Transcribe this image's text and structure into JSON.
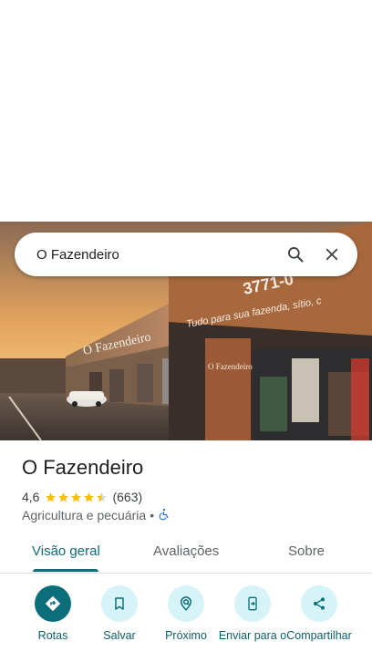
{
  "search": {
    "query": "O Fazendeiro"
  },
  "place": {
    "name": "O Fazendeiro",
    "rating": "4,6",
    "stars": 4.5,
    "review_count": "(663)",
    "category": "Agricultura e pecuária",
    "separator": "•"
  },
  "photo_signage": {
    "phone": "3771-0",
    "slogan": "Tudo para sua fazenda, sítio, c",
    "store_name": "O Fazendeiro"
  },
  "tabs": [
    {
      "label": "Visão geral",
      "active": true
    },
    {
      "label": "Avaliações",
      "active": false
    },
    {
      "label": "Sobre",
      "active": false
    }
  ],
  "actions": [
    {
      "label": "Rotas",
      "icon": "directions-icon"
    },
    {
      "label": "Salvar",
      "icon": "bookmark-icon"
    },
    {
      "label": "Próximo",
      "icon": "nearby-icon"
    },
    {
      "label": "Enviar para o",
      "icon": "send-to-phone-icon"
    },
    {
      "label": "Compartilhar",
      "icon": "share-icon"
    }
  ],
  "colors": {
    "accent": "#0b6e79",
    "star": "#fbbc04",
    "action_bg": "#d6f4f7"
  }
}
